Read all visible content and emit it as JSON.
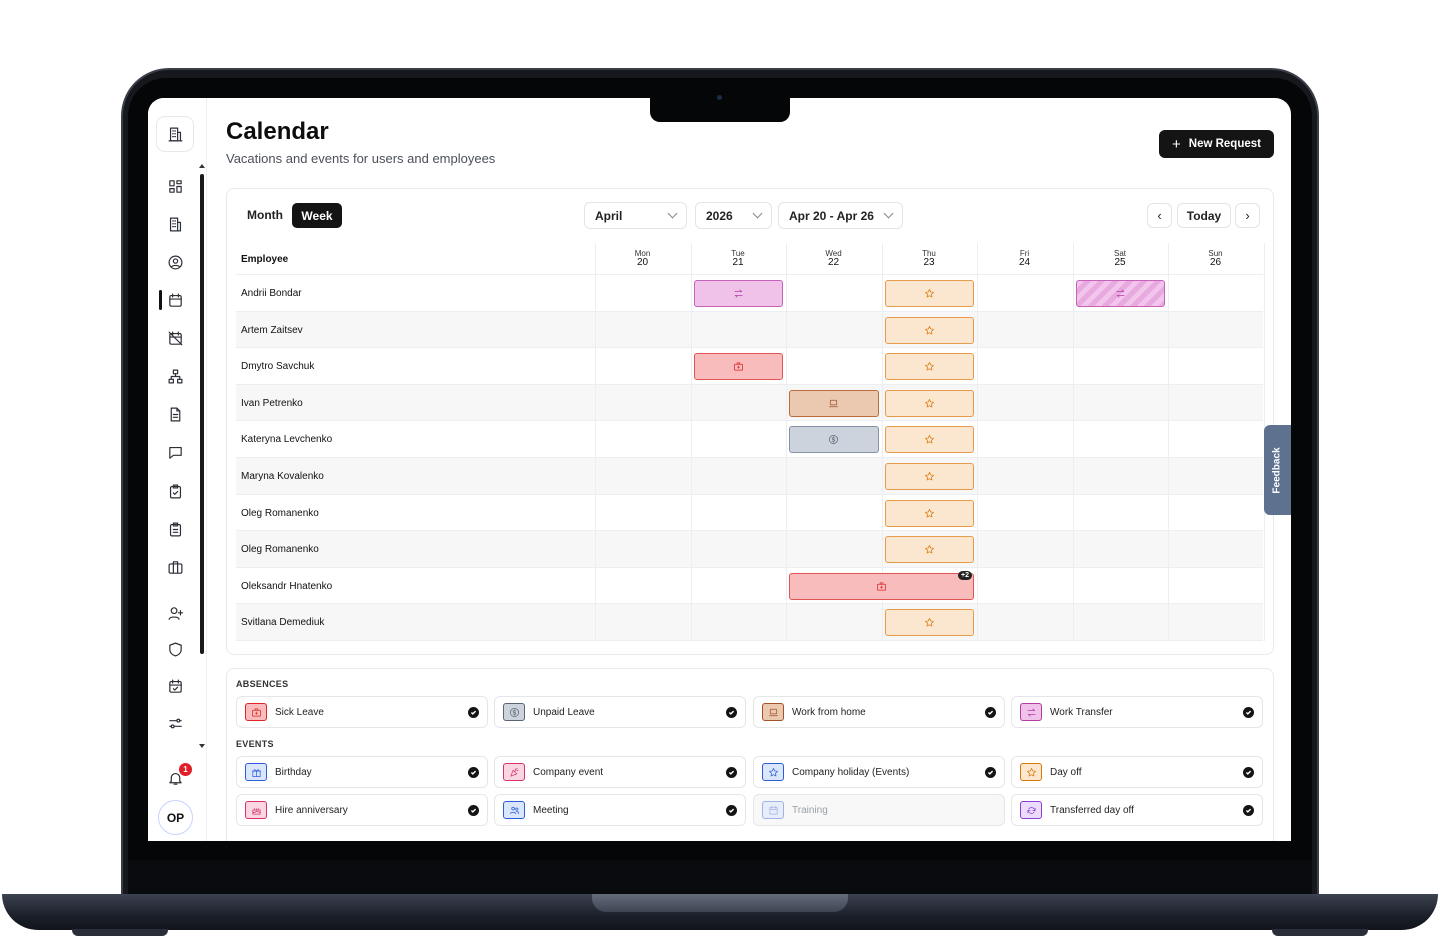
{
  "header": {
    "title": "Calendar",
    "subtitle": "Vacations and events for users and employees",
    "new_request_label": "New Request"
  },
  "sidebar": {
    "notification_count": "1",
    "avatar_initials": "OP",
    "icons": [
      "building-icon",
      "dashboard-icon",
      "office-icon",
      "user-circle-icon",
      "calendar-icon",
      "calendar-off-icon",
      "org-chart-icon",
      "document-icon",
      "message-icon",
      "clipboard-check-icon",
      "clipboard-list-icon",
      "briefcase-icon",
      "user-plus-icon",
      "shield-icon",
      "calendar-check-icon",
      "settings-sliders-icon",
      "bell-icon"
    ]
  },
  "toolbar": {
    "view_month": "Month",
    "view_week": "Week",
    "active_view": "Week",
    "month_select": "April",
    "year_select": "2026",
    "range_select": "Apr 20 - Apr 26",
    "today_label": "Today",
    "prev_icon": "chevron-left-icon",
    "next_icon": "chevron-right-icon"
  },
  "grid": {
    "employee_header": "Employee",
    "days": [
      {
        "dow": "Mon",
        "date": "20"
      },
      {
        "dow": "Tue",
        "date": "21"
      },
      {
        "dow": "Wed",
        "date": "22"
      },
      {
        "dow": "Thu",
        "date": "23"
      },
      {
        "dow": "Fri",
        "date": "24"
      },
      {
        "dow": "Sat",
        "date": "25"
      },
      {
        "dow": "Sun",
        "date": "26"
      }
    ],
    "employees": [
      "Andrii Bondar",
      "Artem Zaitsev",
      "Dmytro Savchuk",
      "Ivan Petrenko",
      "Kateryna Levchenko",
      "Maryna Kovalenko",
      "Oleg Romanenko",
      "Oleg Romanenko",
      "Oleksandr Hnatenko",
      "Svitlana Demediuk"
    ],
    "events": [
      {
        "row": 0,
        "day": 1,
        "span": 1,
        "type": "transfer"
      },
      {
        "row": 0,
        "day": 3,
        "span": 1,
        "type": "star"
      },
      {
        "row": 0,
        "day": 5,
        "span": 1,
        "type": "transfer-hatch"
      },
      {
        "row": 1,
        "day": 3,
        "span": 1,
        "type": "star"
      },
      {
        "row": 2,
        "day": 1,
        "span": 1,
        "type": "sick"
      },
      {
        "row": 2,
        "day": 3,
        "span": 1,
        "type": "star"
      },
      {
        "row": 3,
        "day": 2,
        "span": 1,
        "type": "wfh"
      },
      {
        "row": 3,
        "day": 3,
        "span": 1,
        "type": "star"
      },
      {
        "row": 4,
        "day": 2,
        "span": 1,
        "type": "unpaid"
      },
      {
        "row": 4,
        "day": 3,
        "span": 1,
        "type": "star"
      },
      {
        "row": 5,
        "day": 3,
        "span": 1,
        "type": "star"
      },
      {
        "row": 6,
        "day": 3,
        "span": 1,
        "type": "star"
      },
      {
        "row": 7,
        "day": 3,
        "span": 1,
        "type": "star"
      },
      {
        "row": 8,
        "day": 2,
        "span": 2,
        "type": "sick",
        "more": "+2"
      },
      {
        "row": 9,
        "day": 3,
        "span": 1,
        "type": "star"
      }
    ]
  },
  "legend": {
    "absences_title": "ABSENCES",
    "events_title": "EVENTS",
    "absences": [
      {
        "label": "Sick Leave",
        "icon": "medical-bag-icon",
        "bg": "#f8bcbc",
        "fg": "#dc2626",
        "checked": true
      },
      {
        "label": "Unpaid Leave",
        "icon": "coin-icon",
        "bg": "#ccd3dd",
        "fg": "#5b6474",
        "checked": true
      },
      {
        "label": "Work from home",
        "icon": "laptop-icon",
        "bg": "#ebc9b0",
        "fg": "#a0522d",
        "checked": true
      },
      {
        "label": "Work Transfer",
        "icon": "transfer-icon",
        "bg": "#f0c2ea",
        "fg": "#b23ca4",
        "checked": true
      }
    ],
    "events": [
      {
        "label": "Birthday",
        "icon": "gift-icon",
        "bg": "#dbe5fb",
        "fg": "#2b5fd9",
        "checked": true
      },
      {
        "label": "Company event",
        "icon": "party-icon",
        "bg": "#fbd5e0",
        "fg": "#d6336c",
        "checked": true
      },
      {
        "label": "Company holiday (Events)",
        "icon": "star-icon",
        "bg": "#dbe5fb",
        "fg": "#2b5fd9",
        "checked": true
      },
      {
        "label": "Day off",
        "icon": "star-icon",
        "bg": "#fbe6cf",
        "fg": "#d97706",
        "checked": true
      },
      {
        "label": "Hire anniversary",
        "icon": "cake-icon",
        "bg": "#fbd5e0",
        "fg": "#d6336c",
        "checked": true
      },
      {
        "label": "Meeting",
        "icon": "users-icon",
        "bg": "#dbe5fb",
        "fg": "#2b5fd9",
        "checked": true
      },
      {
        "label": "Training",
        "icon": "calendar-icon",
        "bg": "#e8edfb",
        "fg": "#9fb3e6",
        "checked": false
      },
      {
        "label": "Transferred day off",
        "icon": "refresh-icon",
        "bg": "#ecdcfb",
        "fg": "#8b3fd9",
        "checked": true
      }
    ]
  },
  "feedback_label": "Feedback"
}
